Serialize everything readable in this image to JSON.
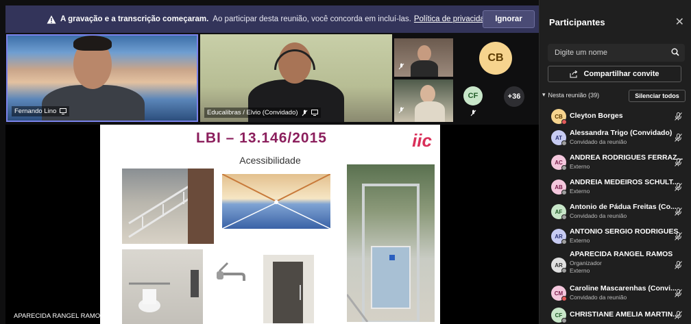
{
  "banner": {
    "bold": "A gravação e a transcrição começaram.",
    "text": "Ao participar desta reunião, você concorda em incluí-las.",
    "link": "Política de privacidade",
    "ignore_label": "Ignorar"
  },
  "tiles": {
    "fernando": "Fernando Lino",
    "elvio": "Educalibras / Elvio (Convidado)",
    "avatar_cb": "CB",
    "avatar_cf": "CF",
    "more": "+36"
  },
  "slide": {
    "title": "LBI – 13.146/2015",
    "logo": "iic",
    "subtitle": "Acessibilidade"
  },
  "presenter": "APARECIDA RANGEL RAMOS",
  "panel": {
    "title": "Participantes",
    "search_placeholder": "Digite um nome",
    "share_label": "Compartilhar convite",
    "section_label": "Nesta reunião (39)",
    "mute_all": "Silenciar todos",
    "participants": [
      {
        "initials": "CB",
        "name": "Cleyton Borges",
        "role": "",
        "role2": "",
        "color": "#f6d48e",
        "fg": "#5b3a00",
        "status": "#e25a5a"
      },
      {
        "initials": "AT",
        "name": "Alessandra Trigo (Convidado)",
        "role": "Convidado da reunião",
        "role2": "",
        "color": "#c7cbf2",
        "fg": "#2d3577",
        "status": "#9e9e9e"
      },
      {
        "initials": "AC",
        "name": "ANDREA RODRIGUES FERRAZ...",
        "role": "Externo",
        "role2": "",
        "color": "#f4c7dd",
        "fg": "#7a1d4a",
        "status": "#9e9e9e"
      },
      {
        "initials": "AB",
        "name": "ANDREIA MEDEIROS SCHULT...",
        "role": "Externo",
        "role2": "",
        "color": "#f4c7dd",
        "fg": "#7a1d4a",
        "status": "#9e9e9e"
      },
      {
        "initials": "AF",
        "name": "Antonio de Pádua Freitas (Co...",
        "role": "Convidado da reunião",
        "role2": "",
        "color": "#c8e6c9",
        "fg": "#1f5a26",
        "status": "#9e9e9e"
      },
      {
        "initials": "AR",
        "name": "ANTONIO SERGIO RODRIGUES",
        "role": "Externo",
        "role2": "",
        "color": "#c7cbf2",
        "fg": "#2d3577",
        "status": "#9e9e9e"
      },
      {
        "initials": "AR",
        "name": "APARECIDA RANGEL RAMOS",
        "role": "Organizador",
        "role2": "Externo",
        "color": "#e0e0e0",
        "fg": "#333333",
        "status": "#9e9e9e"
      },
      {
        "initials": "CM",
        "name": "Caroline Mascarenhas (Convi...",
        "role": "Convidado da reunião",
        "role2": "",
        "color": "#f4c7dd",
        "fg": "#7a1d4a",
        "status": "#e25a5a"
      },
      {
        "initials": "CF",
        "name": "CHRISTIANE AMELIA MARTIN...",
        "role": "",
        "role2": "",
        "color": "#c8e6c9",
        "fg": "#1f5a26",
        "status": "#9e9e9e"
      }
    ]
  }
}
